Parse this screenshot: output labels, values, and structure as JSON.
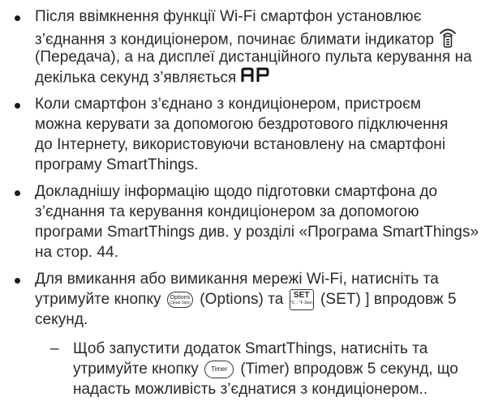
{
  "items": [
    {
      "lines": [
        "Після ввімкнення функції Wi-Fi смартфон установлює",
        "з’єднання з кондиціонером, починає блимати індикатор",
        "(Передача), а на дисплеї дистанційного пульта керування на",
        "декілька секунд з’являється"
      ],
      "display_code": "AP"
    },
    {
      "lines": [
        "Коли смартфон з’єднано з кондиціонером, пристроєм",
        "можна керувати за допомогою бездротового підключення",
        "до Інтернету, використовуючи встановлену на смартфоні",
        "програму SmartThings."
      ]
    },
    {
      "lines": [
        "Докладнішу інформацію щодо підготовки смартфона до",
        "з’єднання та керування кондиціонером за допомогою",
        "програми SmartThings див. у розділі «Програма SmartThings»",
        "на стор. 44."
      ]
    },
    {
      "line1": "Для вмикання або вимикання мережі Wi-Fi, натисніть та",
      "line2_a": "утримуйте кнопку",
      "line2_b": "(Options) та",
      "line2_c": "(SET) ] впродовж 5",
      "line3": "секунд.",
      "options_btn": {
        "top": "Options",
        "bottom": "Clean 3sec"
      },
      "set_btn": {
        "top": "SET",
        "bottom": "°C→°F 3sec"
      }
    }
  ],
  "sub_item": {
    "dash": "–",
    "line1": "Щоб запустити додаток SmartThings, натисніть та",
    "line2_a": "утримуйте кнопку",
    "line2_b": "(Timer) впродовж 5 секунд, що",
    "line3": "надасть можливість з’єднатися з кондиціонером..",
    "timer_btn": "Timer"
  },
  "icons": {
    "transmit": "transmit-indicator-icon"
  }
}
